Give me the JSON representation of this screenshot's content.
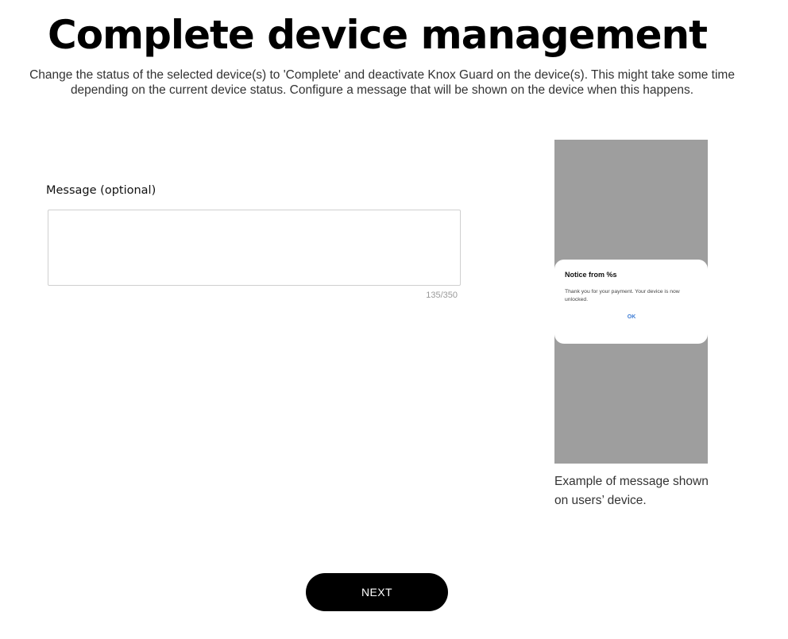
{
  "header": {
    "title": "Complete device management",
    "description": "Change the status of the selected device(s) to 'Complete' and deactivate Knox Guard on the device(s). This might take some time depending on the current device status. Configure a message that will be shown on the device when this happens."
  },
  "form": {
    "message_label": "Message (optional)",
    "message_value": "",
    "message_placeholder": "",
    "char_count": "135/350"
  },
  "preview": {
    "dialog_title": "Notice from %s",
    "dialog_body": "Thank you for your payment. Your device is now unlocked.",
    "dialog_ok": "OK",
    "caption": "Example of message shown on users’ device.",
    "screen_color": "#9e9e9e",
    "ok_color": "#3b7bd4"
  },
  "actions": {
    "next_label": "NEXT"
  }
}
